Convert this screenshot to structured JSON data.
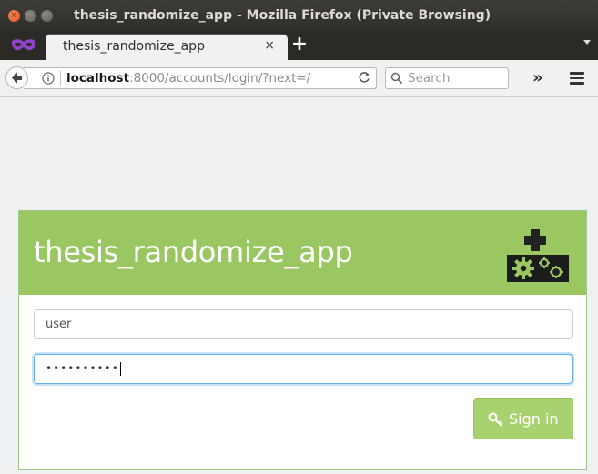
{
  "window": {
    "title": "thesis_randomize_app - Mozilla Firefox (Private Browsing)",
    "close_glyph": "×"
  },
  "tabs": [
    {
      "label": "thesis_randomize_app",
      "close_glyph": "×",
      "active": true
    }
  ],
  "tabbar": {
    "new_tab_glyph": "+",
    "private_icon": "private-browsing-mask-icon"
  },
  "navbar": {
    "url_host": "localhost",
    "url_rest": ":8000/accounts/login/?next=/",
    "search_placeholder": "Search",
    "overflow_glyph": "»",
    "icons": [
      "back-arrow-icon",
      "info-icon",
      "reload-icon",
      "search-icon",
      "menu-icon"
    ]
  },
  "page": {
    "app_title": "thesis_randomize_app",
    "logo_icon": "add-gears-icon",
    "username_value": "user",
    "password_value": "••••••••••",
    "signin_label": "Sign in",
    "signin_icon": "key-icon",
    "accent_color": "#9bc763"
  }
}
